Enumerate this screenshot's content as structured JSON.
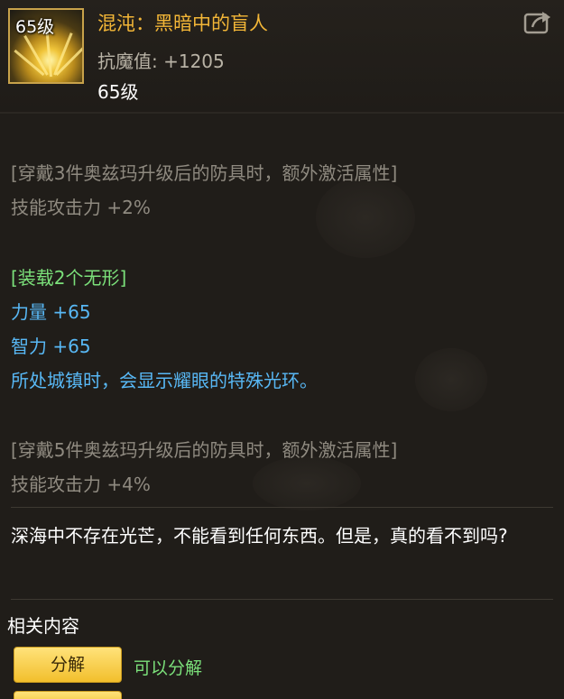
{
  "item": {
    "icon_level": "65级",
    "name": "混沌：黑暗中的盲人",
    "stat": "抗魔值: +1205",
    "level": "65级",
    "icon": "share-icon"
  },
  "set_bonus_3": {
    "header": "[穿戴3件奥兹玛升级后的防具时，额外激活属性]",
    "effect": "技能攻击力 +2%"
  },
  "equip_bonus": {
    "header": "[装载2个无形]",
    "lines": [
      "力量 +65",
      "智力 +65",
      "所处城镇时，会显示耀眼的特殊光环。"
    ]
  },
  "set_bonus_5": {
    "header": "[穿戴5件奥兹玛升级后的防具时，额外激活属性]",
    "effect": "技能攻击力 +4%"
  },
  "description": "深海中不存在光芒，不能看到任何东西。但是，真的看不到吗?",
  "related": {
    "title": "相关内容",
    "button_label": "分解",
    "note": "可以分解"
  },
  "colors": {
    "name": "#f3b637",
    "grey": "#8f8a80",
    "green": "#7be07a",
    "blue": "#58b8f5"
  }
}
